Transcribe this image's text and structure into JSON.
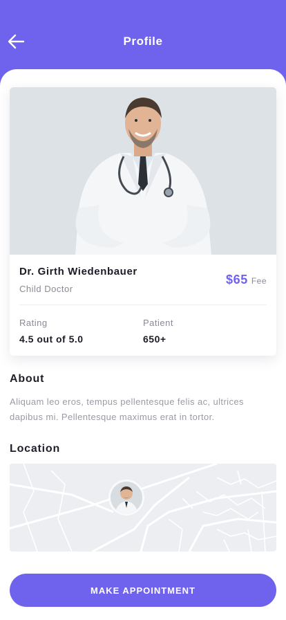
{
  "header": {
    "title": "Profile",
    "back_icon": "arrow-left-icon"
  },
  "doctor": {
    "name": "Dr. Girth Wiedenbauer",
    "specialty": "Child Doctor",
    "fee_amount": "$65",
    "fee_label": "Fee",
    "stats": [
      {
        "label": "Rating",
        "value": "4.5 out of 5.0"
      },
      {
        "label": "Patient",
        "value": "650+"
      }
    ]
  },
  "about": {
    "title": "About",
    "text": "Aliquam leo eros, tempus pellentesque felis ac, ultrices dapibus mi. Pellentesque maximus erat in tortor."
  },
  "location": {
    "title": "Location"
  },
  "actions": {
    "appointment_label": "MAKE APPOINTMENT"
  },
  "colors": {
    "accent": "#6F62EC",
    "text_muted": "#8a8a94"
  }
}
